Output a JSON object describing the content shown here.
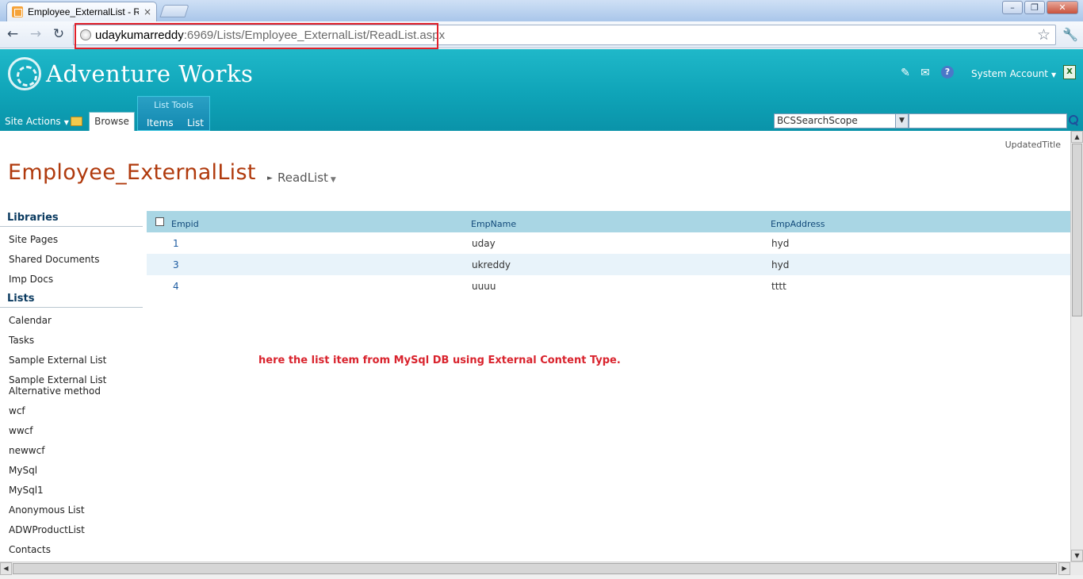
{
  "browser": {
    "tab_title": "Employee_ExternalList - Read",
    "tab_close": "×",
    "window_buttons": {
      "minimize": "–",
      "maximize": "❐",
      "close": "✕"
    },
    "nav": {
      "back": "←",
      "forward": "→",
      "reload": "↻"
    },
    "url_host": "udaykumarreddy",
    "url_rest": ":6969/Lists/Employee_ExternalList/ReadList.aspx",
    "star": "☆",
    "wrench": "🔧"
  },
  "header": {
    "site_title": "Adventure Works",
    "account": "System Account",
    "help": "?",
    "site_actions": "Site Actions",
    "tabs": {
      "browse": "Browse",
      "list_tools": "List Tools",
      "items": "Items",
      "list": "List"
    },
    "search_scope": "BCSSearchScope",
    "search_placeholder": ""
  },
  "page": {
    "updated_title": "UpdatedTitle",
    "title": "Employee_ExternalList",
    "view": "ReadList"
  },
  "quicklaunch": {
    "libraries_heading": "Libraries",
    "libraries": [
      "Site Pages",
      "Shared Documents",
      "Imp Docs"
    ],
    "lists_heading": "Lists",
    "lists": [
      "Calendar",
      "Tasks",
      "Sample External List",
      "Sample External List Alternative method",
      "wcf",
      "wwcf",
      "newwcf",
      "MySql",
      "MySql1",
      "Anonymous List",
      "ADWProductList",
      "Contacts"
    ]
  },
  "grid": {
    "columns": [
      "Empid",
      "EmpName",
      "EmpAddress"
    ],
    "rows": [
      [
        "1",
        "uday",
        "hyd"
      ],
      [
        "3",
        "ukreddy",
        "hyd"
      ],
      [
        "4",
        "uuuu",
        "tttt"
      ]
    ]
  },
  "annotation": "here the list item from MySql DB using External Content Type.",
  "colors": {
    "ribbon": "#0fa4b8",
    "title": "#b03a0d",
    "annotation": "#d9232d",
    "url_highlight": "#e0202a"
  }
}
